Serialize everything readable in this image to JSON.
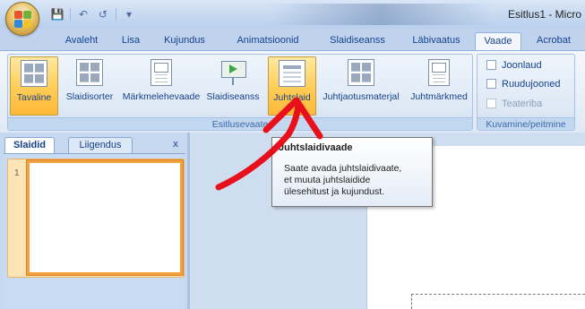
{
  "window": {
    "title": "Esitlus1 - Micro"
  },
  "quick_access": {
    "save_icon": "save-icon",
    "undo_icon": "undo-icon",
    "redo_icon": "redo-icon",
    "customize_icon": "customize-qat-icon"
  },
  "ribbon_tabs": [
    {
      "label": "Avaleht"
    },
    {
      "label": "Lisa"
    },
    {
      "label": "Kujundus"
    },
    {
      "label": "Animatsioonid"
    },
    {
      "label": "Slaidiseanss"
    },
    {
      "label": "Läbivaatus"
    },
    {
      "label": "Vaade",
      "active": true
    },
    {
      "label": "Acrobat"
    }
  ],
  "groups": {
    "presentation_views": {
      "label": "Esitlusevaate",
      "buttons": [
        {
          "label": "Tavaline",
          "selected": true
        },
        {
          "label": "Slaidisorter"
        },
        {
          "label": "Märkmelehevaade"
        },
        {
          "label": "Slaidiseanss"
        },
        {
          "label": "Juhtslaid",
          "selected": true
        },
        {
          "label": "Juhtjaotusmaterjal"
        },
        {
          "label": "Juhtmärkmed"
        }
      ]
    },
    "show_hide": {
      "label": "Kuvamine/peitmine",
      "items": [
        {
          "label": "Joonlaud",
          "checked": false
        },
        {
          "label": "Ruudujooned",
          "checked": false
        },
        {
          "label": "Teateriba",
          "checked": false,
          "disabled": true
        }
      ]
    }
  },
  "left_pane": {
    "tab_slides": "Slaidid",
    "tab_outline": "Liigendus",
    "close_glyph": "x",
    "slide_number": "1"
  },
  "tooltip": {
    "title": "Juhtslaidivaade",
    "lines": [
      "Saate avada juhtslaidivaate,",
      "et muuta juhtslaidide",
      "ülesehitust ja kujundust."
    ]
  },
  "colors": {
    "accent_selected": "#ffcf5a",
    "ribbon_blue": "#dfe9f5",
    "arrow_red": "#e8101a"
  }
}
